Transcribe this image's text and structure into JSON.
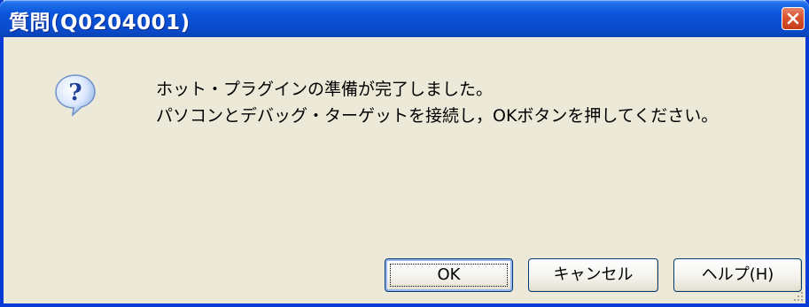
{
  "window": {
    "title": "質問(Q0204001)"
  },
  "message": {
    "line1": "ホット・プラグインの準備が完了しました。",
    "line2": "パソコンとデバッグ・ターゲットを接続し，OKボタンを押してください。"
  },
  "buttons": {
    "ok_label": "OK",
    "cancel_label": "キャンセル",
    "help_label": "ヘルプ(H)"
  },
  "icons": {
    "question": "question-icon",
    "close": "close-icon",
    "grip": "resize-grip-icon"
  },
  "colors": {
    "titlebar": "#0a4fd3",
    "dialog_bg": "#ece9d8",
    "close_button": "#d9532f"
  }
}
